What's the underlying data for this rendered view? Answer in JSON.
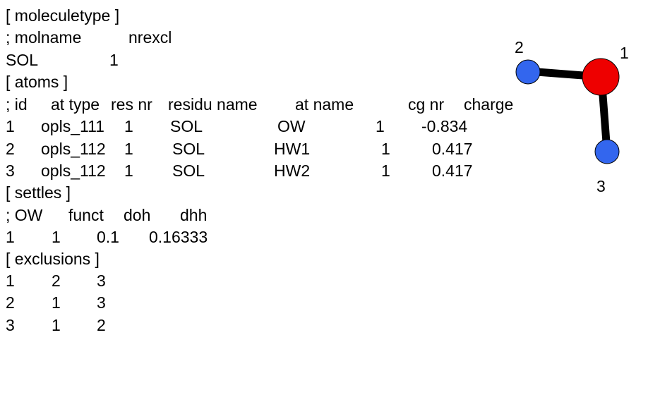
{
  "topology": {
    "moleculetype_header": "[ moleculetype ]",
    "moleculetype_cols": {
      "c0": "; molname",
      "c1": "nrexcl"
    },
    "moleculetype_row": {
      "c0": "SOL",
      "c1": "1"
    },
    "atoms_header": "[ atoms ]",
    "atoms_cols": {
      "c0": "; id",
      "c1": "at type",
      "c2": "res nr",
      "c3": "residu name",
      "c4": "at name",
      "c5": "cg nr",
      "c6": "charge"
    },
    "atoms_rows": [
      {
        "c0": "1",
        "c1": "opls_111",
        "c2": "1",
        "c3": "SOL",
        "c4": "OW",
        "c5": "1",
        "c6": "-0.834"
      },
      {
        "c0": "2",
        "c1": "opls_112",
        "c2": "1",
        "c3": "SOL",
        "c4": "HW1",
        "c5": "1",
        "c6": "0.417"
      },
      {
        "c0": "3",
        "c1": "opls_112",
        "c2": "1",
        "c3": "SOL",
        "c4": "HW2",
        "c5": "1",
        "c6": "0.417"
      }
    ],
    "settles_header": "[ settles ]",
    "settles_cols": {
      "c0": "; OW",
      "c1": "funct",
      "c2": "doh",
      "c3": "dhh"
    },
    "settles_row": {
      "c0": "1",
      "c1": "1",
      "c2": "0.1",
      "c3": "0.16333"
    },
    "exclusions_header": "[ exclusions ]",
    "exclusions_rows": [
      {
        "c0": "1",
        "c1": "2",
        "c2": "3"
      },
      {
        "c0": "2",
        "c1": "1",
        "c2": "3"
      },
      {
        "c0": "3",
        "c1": "1",
        "c2": "2"
      }
    ]
  },
  "molecule": {
    "atom_labels": [
      "1",
      "2",
      "3"
    ],
    "colors": {
      "oxygen": "#ee0000",
      "hydrogen": "#3366ee",
      "bond": "#000000"
    }
  }
}
